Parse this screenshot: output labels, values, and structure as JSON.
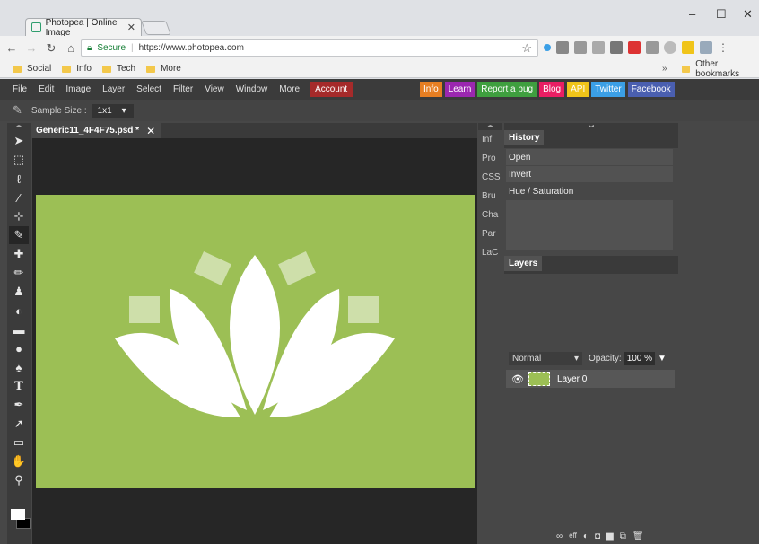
{
  "browser": {
    "tab_title": "Photopea | Online Image",
    "tab_close": "✕",
    "win_minimize": "–",
    "win_maximize": "☐",
    "win_close": "✕",
    "url_secure": "Secure",
    "url": "https://www.photopea.com",
    "bookmarks": [
      "Social",
      "Info",
      "Tech",
      "More"
    ],
    "bookmarks_overflow": "»",
    "other_bookmarks": "Other bookmarks"
  },
  "app": {
    "menu": [
      "File",
      "Edit",
      "Image",
      "Layer",
      "Select",
      "Filter",
      "View",
      "Window",
      "More"
    ],
    "account": "Account",
    "links": [
      {
        "label": "Info",
        "color": "#e67e22"
      },
      {
        "label": "Learn",
        "color": "#9b27b0"
      },
      {
        "label": "Report a bug",
        "color": "#3f9f3f"
      },
      {
        "label": "Blog",
        "color": "#e91e63"
      },
      {
        "label": "API",
        "color": "#f0c419"
      },
      {
        "label": "Twitter",
        "color": "#3b9fe6"
      },
      {
        "label": "Facebook",
        "color": "#4a5fb0"
      }
    ],
    "options": {
      "sample_size_label": "Sample Size :",
      "sample_size_value": "1x1"
    },
    "document": {
      "tab_title": "Generic11_4F4F75.psd *",
      "tab_close": "✕",
      "canvas_color": "#9cbf55"
    },
    "mini_panel": [
      "Inf",
      "Pro",
      "CSS",
      "Bru",
      "Cha",
      "Par",
      "LaC"
    ],
    "history": {
      "tab": "History",
      "items": [
        "Open",
        "Invert",
        "Hue / Saturation"
      ]
    },
    "layers": {
      "tab": "Layers",
      "blend_mode": "Normal",
      "opacity_label": "Opacity:",
      "opacity_value": "100 %",
      "items": [
        {
          "name": "Layer 0"
        }
      ],
      "footer_icons": [
        "link-icon",
        "effects-icon",
        "adjustment-icon",
        "mask-icon",
        "folder-icon",
        "new-layer-icon",
        "trash-icon"
      ],
      "footer_fx": "eff"
    }
  }
}
